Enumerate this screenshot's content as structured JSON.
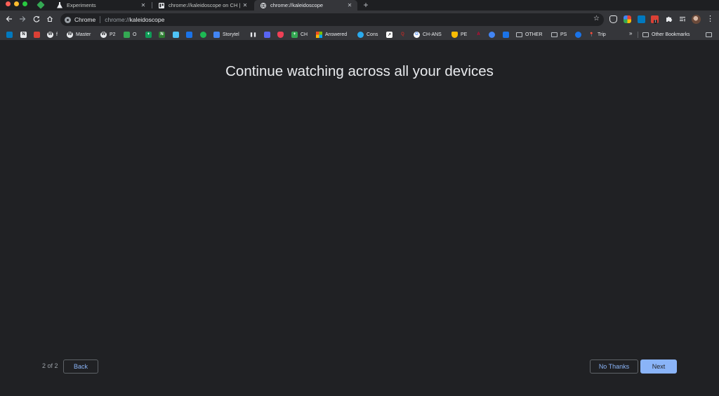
{
  "window": {
    "traffic_lights": {
      "close": "#ff5f57",
      "minimize": "#febc2e",
      "zoom": "#28c840"
    }
  },
  "tabs": [
    {
      "title": "Experiments",
      "icon": "flask-icon",
      "active": false
    },
    {
      "title": "chrome://kaleidoscope on CH |",
      "icon": "trello-icon",
      "active": false
    },
    {
      "title": "chrome://kaleidoscope",
      "icon": "globe-icon",
      "active": true
    }
  ],
  "toolbar": {
    "chip": "Chrome",
    "url_scheme": "chrome://",
    "url_host": "kaleidoscope",
    "extension_badge": "1"
  },
  "bookmarks": {
    "items": [
      {
        "label": "",
        "icon": "trello-icon",
        "color": "#0079bf"
      },
      {
        "label": "",
        "icon": "notion-icon",
        "color": "#5f6368"
      },
      {
        "label": "",
        "icon": "todoist-icon",
        "color": "#db4035"
      },
      {
        "label": "f",
        "icon": "wordpress-icon",
        "color": "#5f6368"
      },
      {
        "label": "Master",
        "icon": "wordpress-icon",
        "color": "#5f6368"
      },
      {
        "label": "P2",
        "icon": "wordpress-icon",
        "color": "#5f6368"
      },
      {
        "label": "O",
        "icon": "sheets-icon",
        "color": "#34a853"
      },
      {
        "label": "",
        "icon": "sheets-icon",
        "color": "#0f9d58"
      },
      {
        "label": "",
        "icon": "n-icon",
        "color": "#2e7d32"
      },
      {
        "label": "",
        "icon": "window-icon",
        "color": "#4fc3f7"
      },
      {
        "label": "",
        "icon": "app-icon",
        "color": "#1a73e8"
      },
      {
        "label": "",
        "icon": "spotify-icon",
        "color": "#1db954"
      },
      {
        "label": "Storytel",
        "icon": "docs-icon",
        "color": "#4285f4"
      },
      {
        "label": "",
        "icon": "pause-icon",
        "color": "#35363a"
      },
      {
        "label": "",
        "icon": "discord-icon",
        "color": "#5865f2"
      },
      {
        "label": "",
        "icon": "pocket-icon",
        "color": "#ef4056"
      },
      {
        "label": "CH",
        "icon": "sheets-icon",
        "color": "#34a853"
      },
      {
        "label": "Answered",
        "icon": "microsoft-icon",
        "color": "#f25022"
      },
      {
        "label": "Cons",
        "icon": "telegram-icon",
        "color": "#2aabee"
      },
      {
        "label": "",
        "icon": "arrow-icon",
        "color": "#ffffff"
      },
      {
        "label": "",
        "icon": "q-icon",
        "color": "#b92b27"
      },
      {
        "label": "CH-ANS",
        "icon": "google-icon",
        "color": "#ffffff"
      },
      {
        "label": "PE",
        "icon": "shield-icon",
        "color": "#fbbc04"
      },
      {
        "label": "",
        "icon": "angular-icon",
        "color": "#dd0031"
      },
      {
        "label": "",
        "icon": "globe-icon",
        "color": "#4285f4"
      },
      {
        "label": "",
        "icon": "chart-icon",
        "color": "#1a73e8"
      },
      {
        "label": "OTHER",
        "icon": "folder-icon",
        "color": "#bdc1c6"
      },
      {
        "label": "PS",
        "icon": "folder-icon",
        "color": "#bdc1c6"
      },
      {
        "label": "",
        "icon": "circle-icon",
        "color": "#1a73e8"
      },
      {
        "label": "Trip",
        "icon": "maps-icon",
        "color": "#34a853"
      }
    ],
    "overflow": "»",
    "other_bookmarks": "Other Bookmarks"
  },
  "page": {
    "headline": "Continue watching across all your devices",
    "step": "2 of 2",
    "back_label": "Back",
    "no_thanks_label": "No Thanks",
    "next_label": "Next"
  }
}
